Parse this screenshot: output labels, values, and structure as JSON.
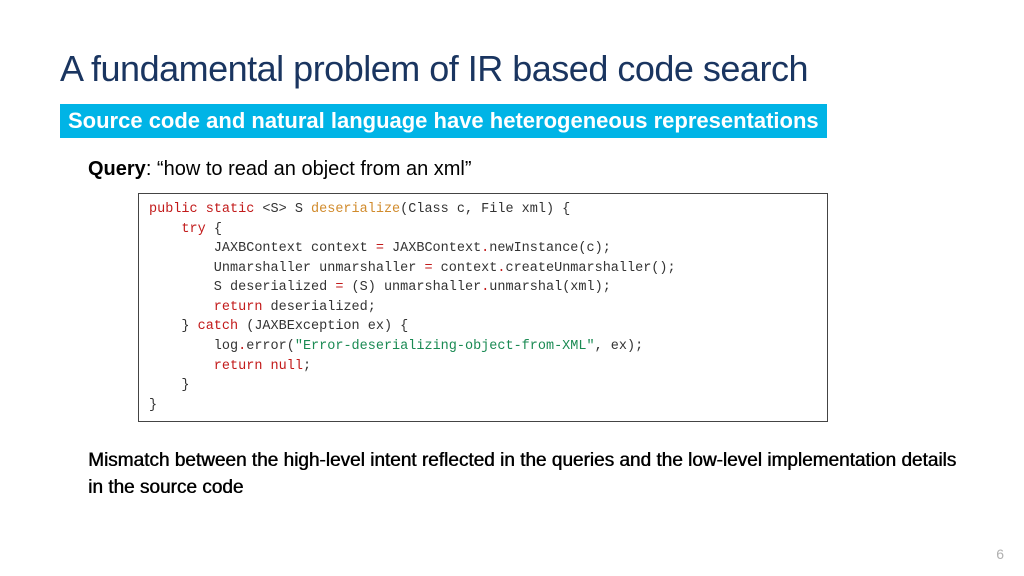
{
  "title": "A fundamental problem of IR based code search",
  "subtitle": "Source code and natural language have heterogeneous representations",
  "query": {
    "label": "Query",
    "text": ": “how to read an object from an xml”"
  },
  "code": {
    "l1a": "public static ",
    "l1b": "<S> S ",
    "l1c": "deserialize",
    "l1d": "(Class c, File xml) {",
    "l2a": "    try ",
    "l2b": "{",
    "l3a": "        JAXBContext context ",
    "l3b": "=",
    "l3c": " JAXBContext",
    "l3d": ".",
    "l3e": "newInstance(c);",
    "l4a": "        Unmarshaller unmarshaller ",
    "l4b": "=",
    "l4c": " context",
    "l4d": ".",
    "l4e": "createUnmarshaller();",
    "l5a": "        S deserialized ",
    "l5b": "=",
    "l5c": " (S) unmarshaller",
    "l5d": ".",
    "l5e": "unmarshal(xml);",
    "l6a": "        return ",
    "l6b": "deserialized;",
    "l7a": "    } ",
    "l7b": "catch ",
    "l7c": "(JAXBException ex) {",
    "l8a": "        log",
    "l8b": ".",
    "l8c": "error(",
    "l8d": "\"Error-deserializing-object-from-XML\"",
    "l8e": ", ex);",
    "l9a": "        return null",
    "l9b": ";",
    "l10": "    }",
    "l11": "}"
  },
  "mismatch": "Mismatch between the high-level intent reflected in the queries and the low-level implementation details in the source code",
  "page_number": "6"
}
